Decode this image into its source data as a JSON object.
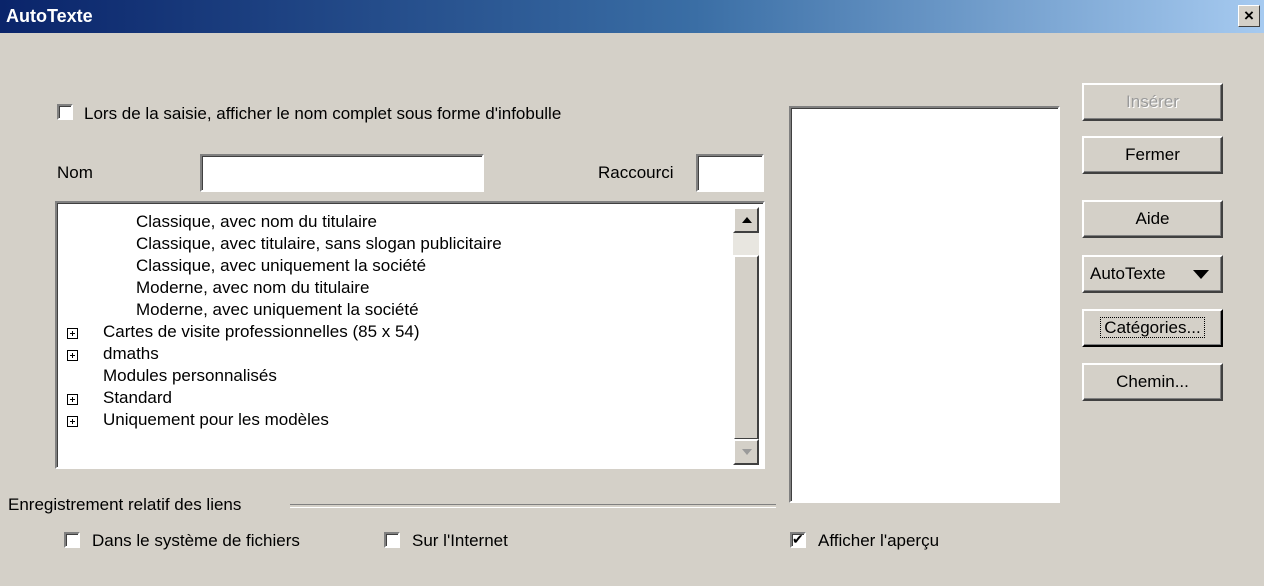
{
  "window": {
    "title": "AutoTexte",
    "close_glyph": "×"
  },
  "tooltip_option": {
    "label": "Lors de la saisie, afficher le nom complet sous forme d'infobulle",
    "checked": false
  },
  "name_field": {
    "label": "Nom",
    "value": ""
  },
  "shortcut_field": {
    "label": "Raccourci",
    "value": ""
  },
  "tree": {
    "items": [
      {
        "label": "Classique, avec nom du titulaire",
        "expandable": false
      },
      {
        "label": "Classique, avec titulaire, sans slogan publicitaire",
        "expandable": false
      },
      {
        "label": "Classique, avec uniquement la société",
        "expandable": false
      },
      {
        "label": "Moderne, avec nom du titulaire",
        "expandable": false
      },
      {
        "label": "Moderne, avec uniquement la société",
        "expandable": false
      },
      {
        "label": "Cartes de visite professionnelles (85 x 54)",
        "expandable": true
      },
      {
        "label": "dmaths",
        "expandable": true
      },
      {
        "label": "Modules personnalisés",
        "expandable": false
      },
      {
        "label": "Standard",
        "expandable": true
      },
      {
        "label": "Uniquement pour les modèles",
        "expandable": true
      }
    ]
  },
  "links_group": {
    "title": "Enregistrement relatif des liens",
    "filesystem": {
      "label": "Dans le système de fichiers",
      "checked": false
    },
    "internet": {
      "label": "Sur l'Internet",
      "checked": false
    }
  },
  "preview": {
    "label": "Afficher l'aperçu",
    "checked": true
  },
  "buttons": {
    "insert": "Insérer",
    "close": "Fermer",
    "help": "Aide",
    "autotext": "AutoTexte",
    "categories": "Catégories...",
    "path": "Chemin..."
  }
}
